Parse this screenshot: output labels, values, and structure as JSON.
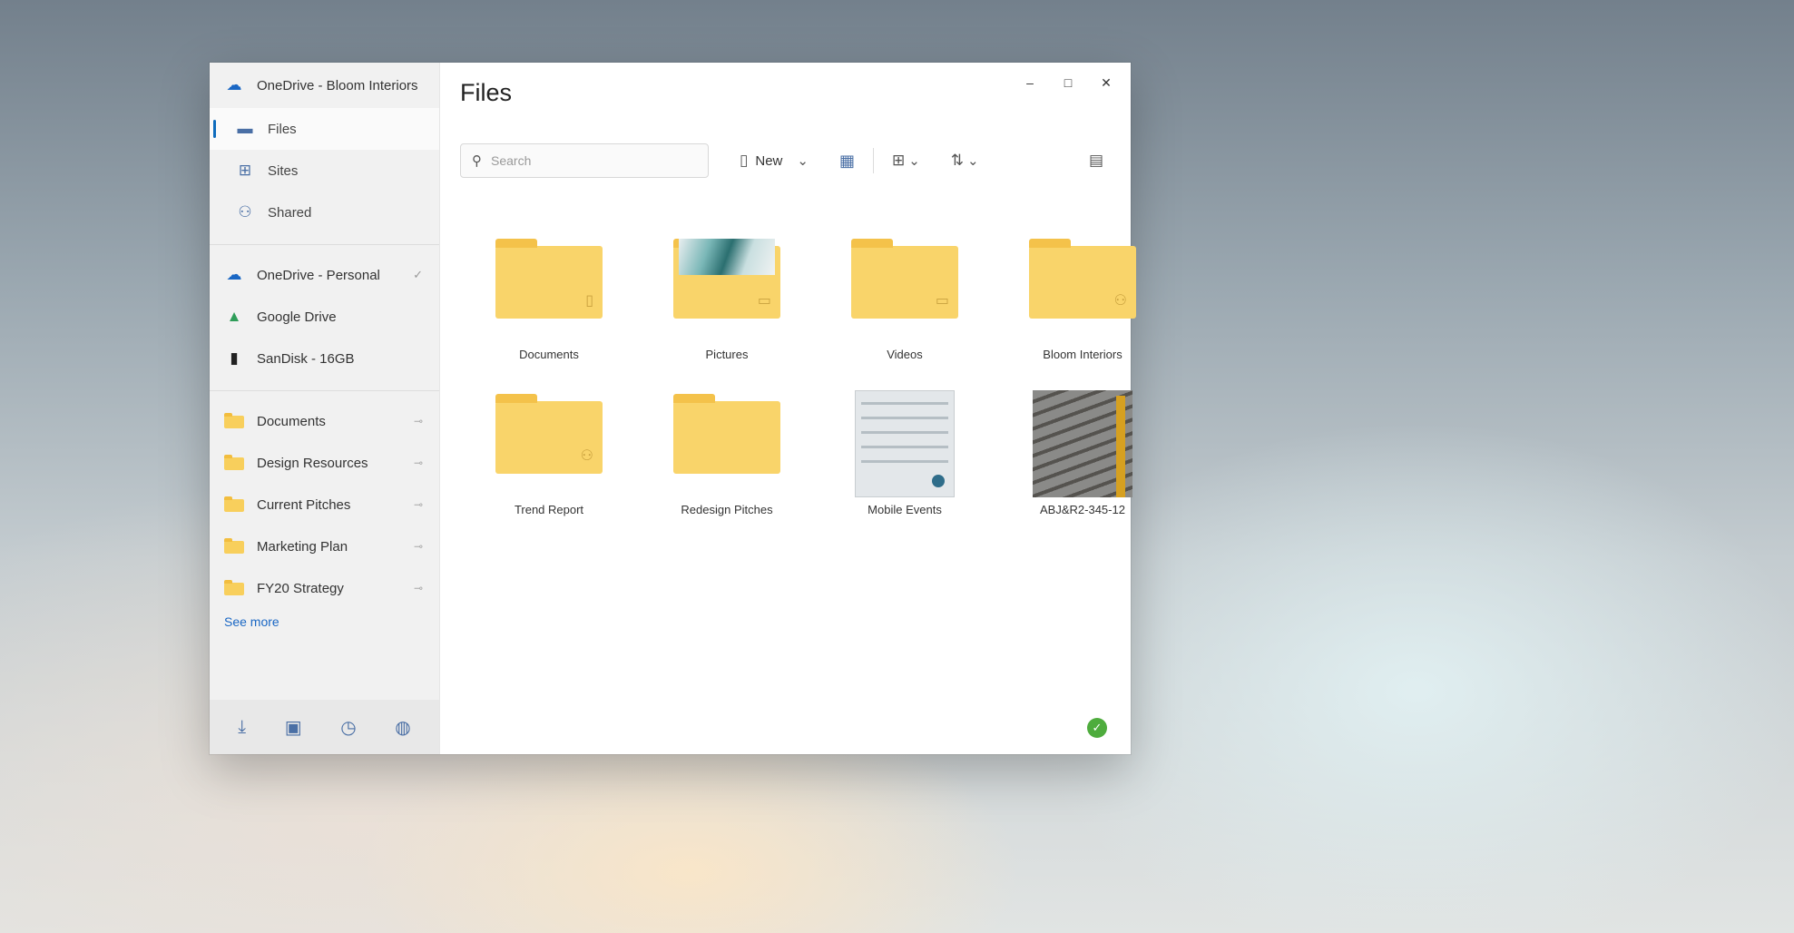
{
  "sidebar": {
    "account": {
      "label": "OneDrive - Bloom Interiors",
      "icon": "onedrive-cloud-icon"
    },
    "nav": [
      {
        "label": "Files",
        "icon": "folder-icon"
      },
      {
        "label": "Sites",
        "icon": "sites-icon"
      },
      {
        "label": "Shared",
        "icon": "shared-icon"
      }
    ],
    "locations": [
      {
        "label": "OneDrive - Personal",
        "icon": "onedrive-cloud-icon",
        "trail": "✓"
      },
      {
        "label": "Google Drive",
        "icon": "google-drive-icon",
        "trail": ""
      },
      {
        "label": "SanDisk - 16GB",
        "icon": "usb-drive-icon",
        "trail": ""
      }
    ],
    "pinned": [
      {
        "label": "Documents"
      },
      {
        "label": "Design Resources"
      },
      {
        "label": "Current Pitches"
      },
      {
        "label": "Marketing Plan"
      },
      {
        "label": "FY20 Strategy"
      }
    ],
    "see_more": "See more",
    "bottom_icons": [
      "download-icon",
      "clipboard-icon",
      "history-icon",
      "settings-globe-icon"
    ]
  },
  "main": {
    "title": "Files",
    "search": {
      "placeholder": "Search",
      "value": ""
    },
    "toolbar": {
      "new_label": "New"
    },
    "items": [
      {
        "name": "Documents",
        "kind": "folder"
      },
      {
        "name": "Pictures",
        "kind": "folder-preview"
      },
      {
        "name": "Videos",
        "kind": "folder"
      },
      {
        "name": "Bloom Interiors",
        "kind": "folder"
      },
      {
        "name": "Trend Report",
        "kind": "folder"
      },
      {
        "name": "Redesign Pitches",
        "kind": "folder"
      },
      {
        "name": "Mobile Events",
        "kind": "image"
      },
      {
        "name": "ABJ&R2-345-12",
        "kind": "image"
      }
    ]
  },
  "colors": {
    "accent": "#0f6cbd",
    "folder": "#f9d46a",
    "sync_ok": "#4eac3d"
  }
}
